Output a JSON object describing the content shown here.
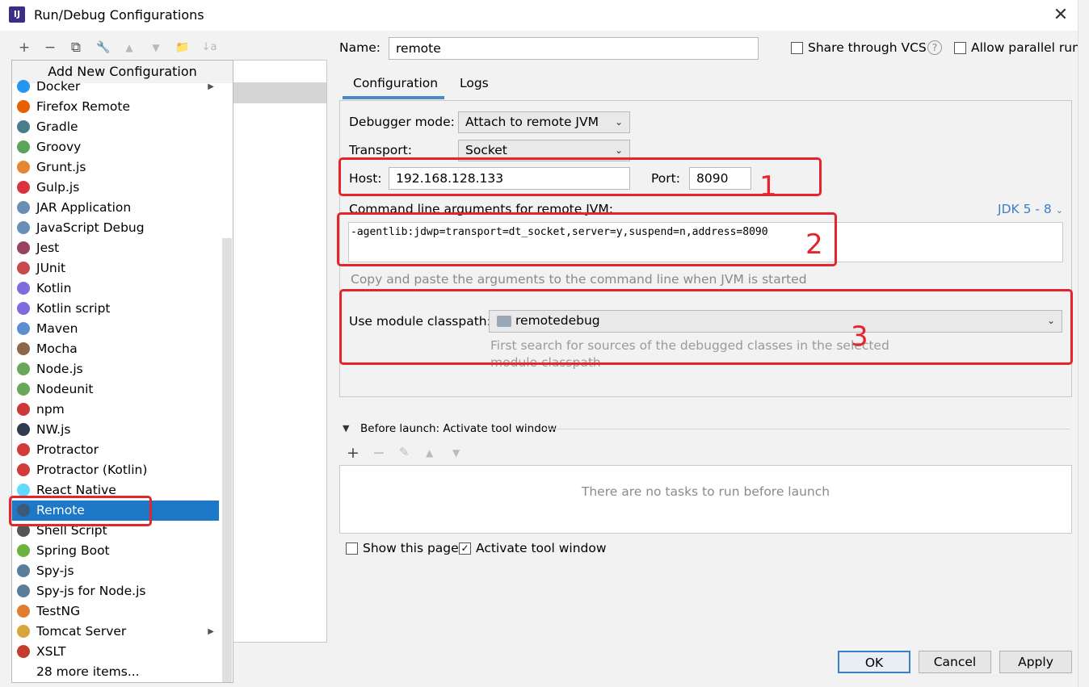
{
  "window": {
    "title": "Run/Debug Configurations",
    "app_icon_text": "IJ"
  },
  "toolbar": {
    "add": "+",
    "remove": "−",
    "copy": "⧉",
    "edit": "🔧",
    "up": "▲",
    "down": "▼",
    "folder": "📁",
    "sort": "↓a"
  },
  "popup": {
    "header": "Add New Configuration",
    "items": [
      {
        "label": "Docker",
        "icon_color": "#2496ed",
        "icon": "docker-icon",
        "submenu": true
      },
      {
        "label": "Firefox Remote",
        "icon_color": "#e66000",
        "icon": "firefox-icon"
      },
      {
        "label": "Gradle",
        "icon_color": "#4a7d8b",
        "icon": "gradle-icon"
      },
      {
        "label": "Groovy",
        "icon_color": "#5aa55a",
        "icon": "groovy-icon"
      },
      {
        "label": "Grunt.js",
        "icon_color": "#e48632",
        "icon": "grunt-icon"
      },
      {
        "label": "Gulp.js",
        "icon_color": "#d9333f",
        "icon": "gulp-icon"
      },
      {
        "label": "JAR Application",
        "icon_color": "#6a8fb5",
        "icon": "jar-icon"
      },
      {
        "label": "JavaScript Debug",
        "icon_color": "#6a8fb5",
        "icon": "javascript-debug-icon"
      },
      {
        "label": "Jest",
        "icon_color": "#99425b",
        "icon": "jest-icon"
      },
      {
        "label": "JUnit",
        "icon_color": "#c9484c",
        "icon": "junit-icon"
      },
      {
        "label": "Kotlin",
        "icon_color": "#7f6ae0",
        "icon": "kotlin-icon"
      },
      {
        "label": "Kotlin script",
        "icon_color": "#7f6ae0",
        "icon": "kotlin-script-icon"
      },
      {
        "label": "Maven",
        "icon_color": "#5b8fd0",
        "icon": "maven-icon"
      },
      {
        "label": "Mocha",
        "icon_color": "#8d6748",
        "icon": "mocha-icon"
      },
      {
        "label": "Node.js",
        "icon_color": "#6aa75a",
        "icon": "nodejs-icon"
      },
      {
        "label": "Nodeunit",
        "icon_color": "#6aa75a",
        "icon": "nodeunit-icon"
      },
      {
        "label": "npm",
        "icon_color": "#cb3837",
        "icon": "npm-icon"
      },
      {
        "label": "NW.js",
        "icon_color": "#2e3c4d",
        "icon": "nwjs-icon"
      },
      {
        "label": "Protractor",
        "icon_color": "#d33b3b",
        "icon": "protractor-icon"
      },
      {
        "label": "Protractor (Kotlin)",
        "icon_color": "#d33b3b",
        "icon": "protractor-kotlin-icon"
      },
      {
        "label": "React Native",
        "icon_color": "#61dafb",
        "icon": "react-native-icon"
      },
      {
        "label": "Remote",
        "icon_color": "#3c5a78",
        "icon": "remote-icon",
        "selected": true
      },
      {
        "label": "Shell Script",
        "icon_color": "#555555",
        "icon": "shell-script-icon"
      },
      {
        "label": "Spring Boot",
        "icon_color": "#6db33f",
        "icon": "spring-boot-icon"
      },
      {
        "label": "Spy-js",
        "icon_color": "#5a7d9a",
        "icon": "spy-js-icon"
      },
      {
        "label": "Spy-js for Node.js",
        "icon_color": "#5a7d9a",
        "icon": "spy-js-node-icon"
      },
      {
        "label": "TestNG",
        "icon_color": "#e47c2f",
        "icon": "testng-icon"
      },
      {
        "label": "Tomcat Server",
        "icon_color": "#d8a53b",
        "icon": "tomcat-icon",
        "submenu": true
      },
      {
        "label": "XSLT",
        "icon_color": "#c23d2e",
        "icon": "xslt-icon"
      },
      {
        "label": "28 more items...",
        "icon_color": "",
        "icon": ""
      }
    ]
  },
  "form": {
    "name_label": "Name:",
    "name_value": "remote",
    "share_vcs_label": "Share through VCS",
    "help": "?",
    "allow_parallel_label": "Allow parallel run",
    "tabs": [
      {
        "label": "Configuration",
        "active": true
      },
      {
        "label": "Logs",
        "active": false
      }
    ],
    "debugger_mode_label": "Debugger mode:",
    "debugger_mode_value": "Attach to remote JVM",
    "transport_label": "Transport:",
    "transport_value": "Socket",
    "host_label": "Host:",
    "host_value": "192.168.128.133",
    "port_label": "Port:",
    "port_value": "8090",
    "cmd_label": "Command line arguments for remote JVM:",
    "jdk_link": "JDK 5 - 8",
    "cmd_value": "-agentlib:jdwp=transport=dt_socket,server=y,suspend=n,address=8090",
    "cmd_hint": "Copy and paste the arguments to the command line when JVM is started",
    "classpath_label": "Use module classpath:",
    "classpath_value": "remotedebug",
    "classpath_hint_line1": "First search for sources of the debugged classes in the selected",
    "classpath_hint_line2": "module classpath",
    "before_launch_label": "Before launch: Activate tool window",
    "no_tasks_text": "There are no tasks to run before launch",
    "show_page_label": "Show this page",
    "activate_tool_label": "Activate tool window"
  },
  "annotations": {
    "n1": "1",
    "n2": "2",
    "n3": "3",
    "color": "#e5242b"
  },
  "buttons": {
    "ok": "OK",
    "cancel": "Cancel",
    "apply": "Apply"
  }
}
